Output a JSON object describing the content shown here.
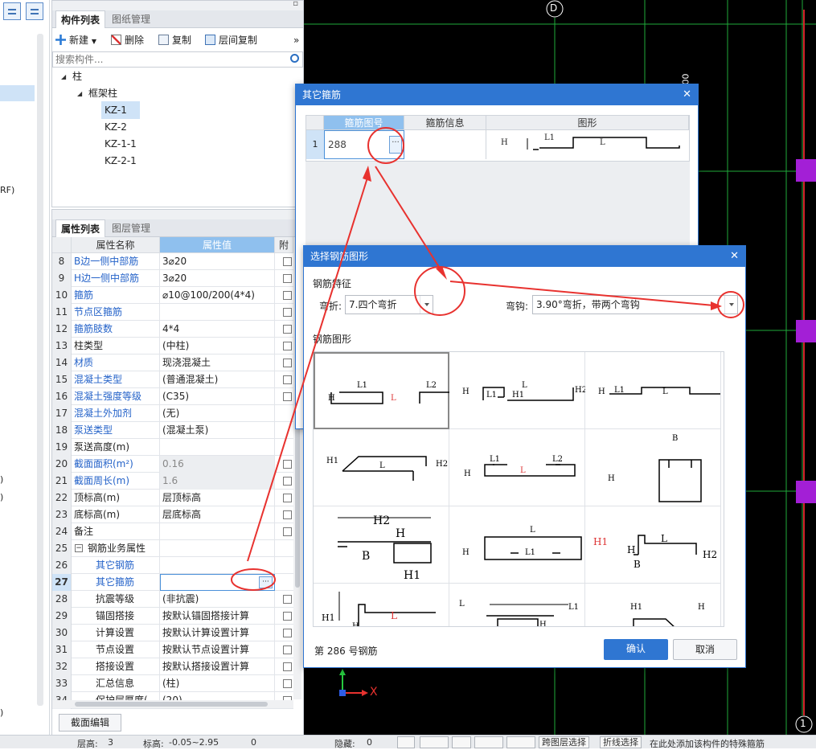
{
  "panel_components": {
    "tabs": [
      "构件列表",
      "图纸管理"
    ],
    "toolbar": {
      "new": "新建",
      "delete": "删除",
      "copy": "复制",
      "layer_copy": "层间复制",
      "more": "»"
    },
    "search_placeholder": "搜索构件...",
    "tree": {
      "root": "柱",
      "group": "框架柱",
      "items": [
        "KZ-1",
        "KZ-2",
        "KZ-1-1",
        "KZ-2-1"
      ]
    }
  },
  "panel_properties": {
    "tabs": [
      "属性列表",
      "图层管理"
    ],
    "headers": {
      "name": "属性名称",
      "value": "属性值",
      "attach": "附"
    },
    "rows": [
      {
        "n": "8",
        "k": "B边一侧中部筋",
        "v": "3⌀20",
        "blue": true,
        "check": true
      },
      {
        "n": "9",
        "k": "H边一侧中部筋",
        "v": "3⌀20",
        "blue": true,
        "check": true
      },
      {
        "n": "10",
        "k": "箍筋",
        "v": "⌀10@100/200(4*4)",
        "blue": true,
        "check": true
      },
      {
        "n": "11",
        "k": "节点区箍筋",
        "v": "",
        "blue": true,
        "check": true
      },
      {
        "n": "12",
        "k": "箍筋肢数",
        "v": "4*4",
        "blue": true,
        "check": true
      },
      {
        "n": "13",
        "k": "柱类型",
        "v": "(中柱)",
        "check": true
      },
      {
        "n": "14",
        "k": "材质",
        "v": "现浇混凝土",
        "blue": true,
        "check": true
      },
      {
        "n": "15",
        "k": "混凝土类型",
        "v": "(普通混凝土)",
        "blue": true,
        "check": true
      },
      {
        "n": "16",
        "k": "混凝土强度等级",
        "v": "(C35)",
        "blue": true,
        "check": true
      },
      {
        "n": "17",
        "k": "混凝土外加剂",
        "v": "(无)",
        "blue": true
      },
      {
        "n": "18",
        "k": "泵送类型",
        "v": "(混凝土泵)",
        "blue": true
      },
      {
        "n": "19",
        "k": "泵送高度(m)",
        "v": ""
      },
      {
        "n": "20",
        "k": "截面面积(m²)",
        "v": "0.16",
        "blue": true,
        "gray": true,
        "check": true
      },
      {
        "n": "21",
        "k": "截面周长(m)",
        "v": "1.6",
        "blue": true,
        "gray": true,
        "check": true
      },
      {
        "n": "22",
        "k": "顶标高(m)",
        "v": "层顶标高",
        "check": true
      },
      {
        "n": "23",
        "k": "底标高(m)",
        "v": "层底标高",
        "check": true
      },
      {
        "n": "24",
        "k": "备注",
        "v": "",
        "check": true
      },
      {
        "n": "25",
        "k": "钢筋业务属性",
        "v": "",
        "group": true
      },
      {
        "n": "26",
        "k": "其它钢筋",
        "v": "",
        "blue": true,
        "child": true
      },
      {
        "n": "27",
        "k": "其它箍筋",
        "v": "",
        "blue": true,
        "child": true,
        "sel": true
      },
      {
        "n": "28",
        "k": "抗震等级",
        "v": "(非抗震)",
        "child": true,
        "check": true
      },
      {
        "n": "29",
        "k": "锚固搭接",
        "v": "按默认锚固搭接计算",
        "child": true,
        "check": true
      },
      {
        "n": "30",
        "k": "计算设置",
        "v": "按默认计算设置计算",
        "child": true,
        "check": true
      },
      {
        "n": "31",
        "k": "节点设置",
        "v": "按默认节点设置计算",
        "child": true,
        "check": true
      },
      {
        "n": "32",
        "k": "搭接设置",
        "v": "按默认搭接设置计算",
        "child": true,
        "check": true
      },
      {
        "n": "33",
        "k": "汇总信息",
        "v": "(柱)",
        "child": true,
        "check": true
      },
      {
        "n": "34",
        "k": "保护层厚度(",
        "v": "(20)",
        "child": true,
        "check": true
      }
    ],
    "section_edit": "截面编辑"
  },
  "left_fragments": [
    "RF)",
    ")",
    ")",
    ")"
  ],
  "cad": {
    "axis_top": "D",
    "axis_bottom": "1",
    "axis_x": "X",
    "side_num": "00"
  },
  "dialog_other_stirrups": {
    "title": "其它箍筋",
    "headers": [
      "箍筋图号",
      "箍筋信息",
      "图形"
    ],
    "row": {
      "n": "1",
      "shape_no": "288",
      "info": ""
    },
    "shape_labels": {
      "h": "H",
      "l1": "L1",
      "l": "L"
    }
  },
  "dialog_select_shape": {
    "title": "选择钢筋图形",
    "feature_label": "钢筋特征",
    "bend_label": "弯折:",
    "bend_value": "7.四个弯折",
    "hook_label": "弯钩:",
    "hook_value": "3.90°弯折，带两个弯钩",
    "shapes_label": "钢筋图形",
    "status": "第 286 号钢筋",
    "ok": "确认",
    "cancel": "取消"
  },
  "status_bar": {
    "floor_height": "层高:",
    "floor_val": "3",
    "elev": "标高:",
    "elev_val": "-0.05~2.95",
    "zero": "0",
    "hidden": "隐藏:",
    "hidden_val": "0",
    "cross_layer": "跨图层选择",
    "polyline": "折线选择",
    "hint": "在此处添加该构件的特殊箍筋"
  },
  "colors": {
    "accent": "#2f76d2",
    "annot": "#e8322f",
    "grid": "#1faa3a",
    "column": "#a31fd6"
  }
}
